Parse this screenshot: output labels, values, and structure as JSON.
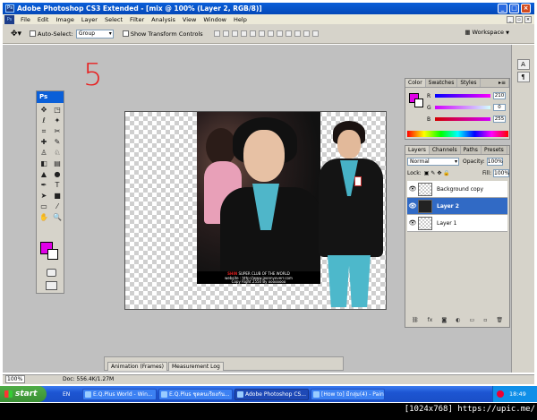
{
  "window": {
    "title": "Adobe Photoshop CS3 Extended - [mix @ 100% (Layer 2, RGB/8)]"
  },
  "menu": [
    "File",
    "Edit",
    "Image",
    "Layer",
    "Select",
    "Filter",
    "Analysis",
    "View",
    "Window",
    "Help"
  ],
  "options": {
    "auto_select_label": "Auto-Select:",
    "auto_select_value": "Group",
    "transform_label": "Show Transform Controls",
    "workspace_label": "Workspace"
  },
  "annotation": "5",
  "toolbox": {
    "title": "Ps",
    "tools": [
      "move-tool",
      "marquee-tool",
      "lasso-tool",
      "magic-wand-tool",
      "crop-tool",
      "slice-tool",
      "healing-brush-tool",
      "brush-tool",
      "clone-stamp-tool",
      "history-brush-tool",
      "eraser-tool",
      "gradient-tool",
      "blur-tool",
      "dodge-tool",
      "pen-tool",
      "type-tool",
      "path-selection-tool",
      "shape-tool",
      "notes-tool",
      "eyedropper-tool",
      "hand-tool",
      "zoom-tool"
    ],
    "glyphs": [
      "✥",
      "◳",
      "ℓ",
      "✦",
      "⌗",
      "✂",
      "✚",
      "✎",
      "♙",
      "♘",
      "◧",
      "▤",
      "▲",
      "●",
      "✒",
      "T",
      "➤",
      "■",
      "▭",
      "⁄",
      "✋",
      "🔍"
    ]
  },
  "colors": {
    "foreground": "#e000e7",
    "background": "#ffffff"
  },
  "photo_caption": {
    "highlight": "SHIN",
    "line1": "SUPER CLUB OF THE WORLD",
    "line2": "website : http://www.jeonnyoverr.com",
    "line3": "Copy Right 2550 By oooooooo"
  },
  "color_panel": {
    "tabs": [
      "Color",
      "Swatches",
      "Styles"
    ],
    "channels": [
      {
        "label": "R",
        "value": "210"
      },
      {
        "label": "G",
        "value": "0"
      },
      {
        "label": "B",
        "value": "255"
      }
    ]
  },
  "layers_panel": {
    "tabs": [
      "Layers",
      "Channels",
      "Paths",
      "Presets"
    ],
    "blend_mode": "Normal",
    "opacity_label": "Opacity:",
    "opacity": "100%",
    "lock_label": "Lock:",
    "fill_label": "Fill:",
    "fill": "100%",
    "layers": [
      {
        "name": "Background copy",
        "selected": false
      },
      {
        "name": "Layer 2",
        "selected": true
      },
      {
        "name": "Layer 1",
        "selected": false
      }
    ]
  },
  "bottom_tabs": [
    "Animation (Frames)",
    "Measurement Log"
  ],
  "status": {
    "zoom": "100%",
    "doc": "Doc: 556.4K/1.27M"
  },
  "taskbar": {
    "start": "start",
    "lang": "EN",
    "items": [
      "E.Q.Plus World - Win...",
      "E.Q.Plus ชุดคนเรียงกัน...",
      "Adobe Photoshop CS...",
      "[How to] มีกลุ่ม(4) - Paint"
    ],
    "active_index": 2,
    "clock": "18:49"
  },
  "watermark": "[1024x768] https://upic.me/"
}
